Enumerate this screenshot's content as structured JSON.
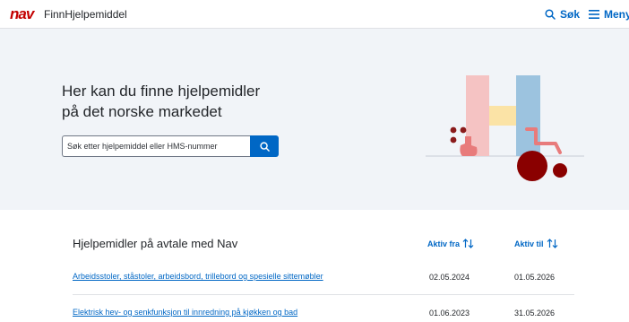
{
  "header": {
    "logo_text": "nav",
    "app_name": "FinnHjelpemiddel",
    "search_label": "Søk",
    "menu_label": "Meny"
  },
  "hero": {
    "title": "Her kan du finne hjelpemidler på det norske markedet",
    "search_placeholder": "Søk etter hjelpemiddel eller HMS-nummer"
  },
  "agreements": {
    "title": "Hjelpemidler på avtale med Nav",
    "columns": {
      "active_from": "Aktiv fra",
      "active_to": "Aktiv til"
    },
    "rows": [
      {
        "name": "Arbeidsstoler, ståstoler, arbeidsbord, trillebord og spesielle sittemøbler",
        "active_from": "02.05.2024",
        "active_to": "01.05.2026"
      },
      {
        "name": "Elektrisk hev- og senkfunksjon til innredning på kjøkken og bad",
        "active_from": "01.06.2023",
        "active_to": "31.05.2026"
      }
    ]
  },
  "colors": {
    "brand_red": "#c30000",
    "link_blue": "#0067c5",
    "hero_bg": "#f1f4f8"
  }
}
